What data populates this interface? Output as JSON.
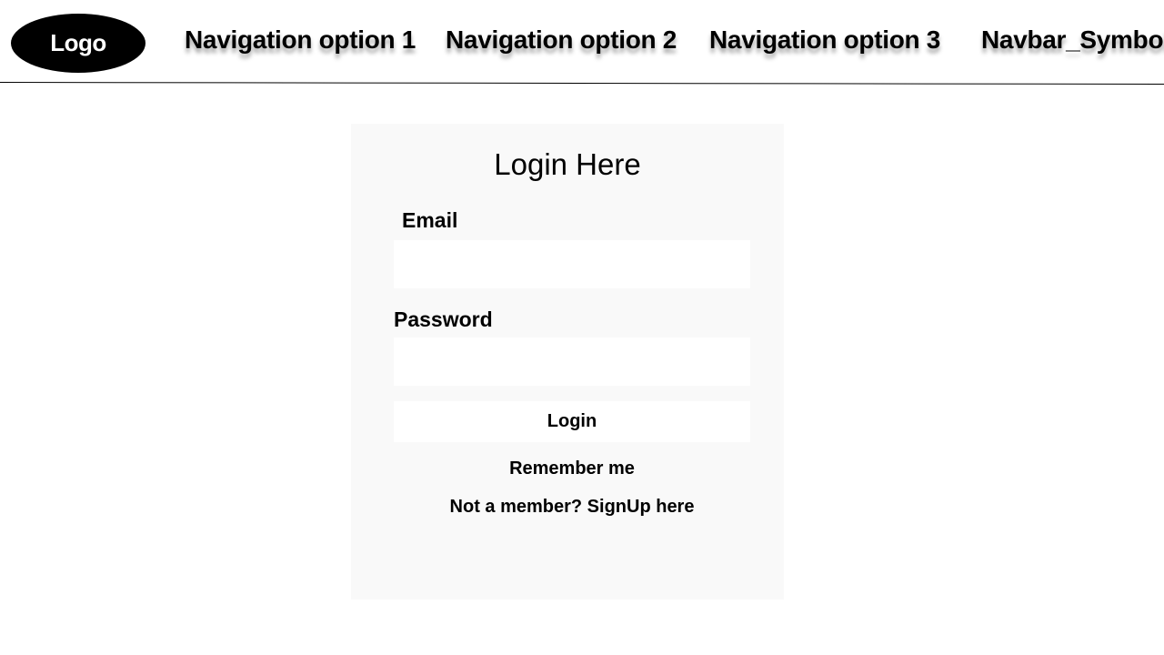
{
  "navbar": {
    "logo": "Logo",
    "items": [
      {
        "label": "Navigation option 1"
      },
      {
        "label": "Navigation option 2"
      },
      {
        "label": "Navigation option 3"
      },
      {
        "label": "Navbar_Symbol"
      }
    ]
  },
  "login": {
    "title": "Login Here",
    "email_label": "Email",
    "email_value": "",
    "password_label": "Password",
    "password_value": "",
    "button_label": "Login",
    "remember_me": "Remember me",
    "signup_text": "Not a member? SignUp here"
  },
  "colors": {
    "card_background": "#f9f9f9",
    "logo_background": "#000000",
    "logo_text": "#ffffff"
  }
}
